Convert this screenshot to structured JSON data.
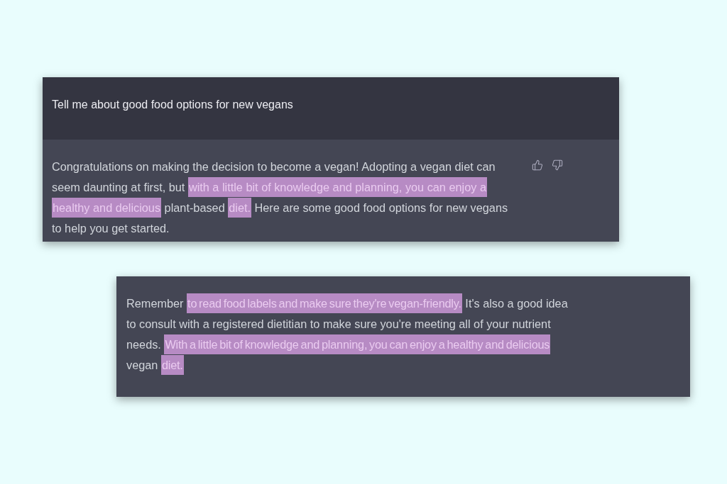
{
  "prompt": {
    "text": "Tell me about good food options for new vegans"
  },
  "response": {
    "segments": [
      {
        "text": "Congratulations on making the decision to become a vegan! Adopting a vegan diet can seem daunting at first, but ",
        "highlighted": false
      },
      {
        "text": "with a little bit of knowledge and planning, you can enjoy a healthy and delicious",
        "highlighted": true
      },
      {
        "text": " plant-based ",
        "highlighted": false
      },
      {
        "text": "diet.",
        "highlighted": true
      },
      {
        "text": " Here are some good food options for new vegans to help you get started.",
        "highlighted": false
      }
    ]
  },
  "excerpt": {
    "segments": [
      {
        "text": "Remember ",
        "highlighted": false
      },
      {
        "text": "to read food labels and make sure they're vegan-friendly.",
        "highlighted": true
      },
      {
        "text": " It's also a good idea to consult with a registered dietitian to make sure you're meeting all of your nutrient needs. ",
        "highlighted": false
      },
      {
        "text": "With a little bit of knowledge and planning, you can enjoy a healthy and delicious",
        "highlighted": true
      },
      {
        "text": " vegan ",
        "highlighted": false
      },
      {
        "text": "diet.",
        "highlighted": true
      }
    ]
  }
}
